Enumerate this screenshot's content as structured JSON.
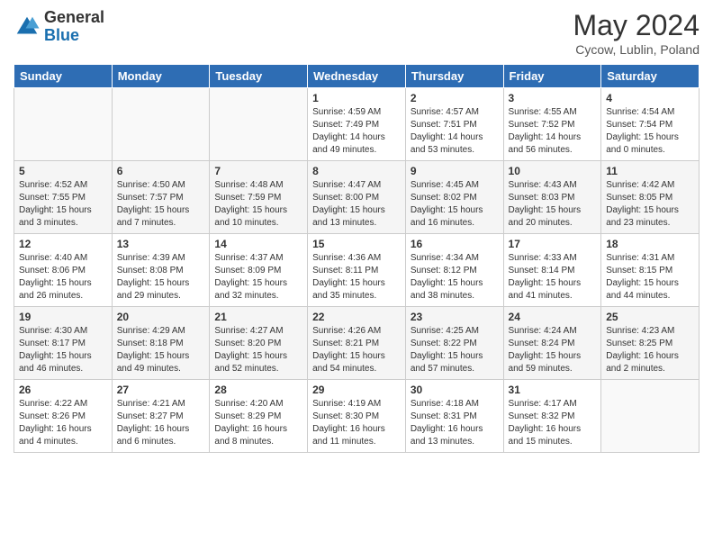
{
  "header": {
    "logo_general": "General",
    "logo_blue": "Blue",
    "month_title": "May 2024",
    "location": "Cycow, Lublin, Poland"
  },
  "days_of_week": [
    "Sunday",
    "Monday",
    "Tuesday",
    "Wednesday",
    "Thursday",
    "Friday",
    "Saturday"
  ],
  "weeks": [
    [
      {
        "day": "",
        "info": ""
      },
      {
        "day": "",
        "info": ""
      },
      {
        "day": "",
        "info": ""
      },
      {
        "day": "1",
        "info": "Sunrise: 4:59 AM\nSunset: 7:49 PM\nDaylight: 14 hours\nand 49 minutes."
      },
      {
        "day": "2",
        "info": "Sunrise: 4:57 AM\nSunset: 7:51 PM\nDaylight: 14 hours\nand 53 minutes."
      },
      {
        "day": "3",
        "info": "Sunrise: 4:55 AM\nSunset: 7:52 PM\nDaylight: 14 hours\nand 56 minutes."
      },
      {
        "day": "4",
        "info": "Sunrise: 4:54 AM\nSunset: 7:54 PM\nDaylight: 15 hours\nand 0 minutes."
      }
    ],
    [
      {
        "day": "5",
        "info": "Sunrise: 4:52 AM\nSunset: 7:55 PM\nDaylight: 15 hours\nand 3 minutes."
      },
      {
        "day": "6",
        "info": "Sunrise: 4:50 AM\nSunset: 7:57 PM\nDaylight: 15 hours\nand 7 minutes."
      },
      {
        "day": "7",
        "info": "Sunrise: 4:48 AM\nSunset: 7:59 PM\nDaylight: 15 hours\nand 10 minutes."
      },
      {
        "day": "8",
        "info": "Sunrise: 4:47 AM\nSunset: 8:00 PM\nDaylight: 15 hours\nand 13 minutes."
      },
      {
        "day": "9",
        "info": "Sunrise: 4:45 AM\nSunset: 8:02 PM\nDaylight: 15 hours\nand 16 minutes."
      },
      {
        "day": "10",
        "info": "Sunrise: 4:43 AM\nSunset: 8:03 PM\nDaylight: 15 hours\nand 20 minutes."
      },
      {
        "day": "11",
        "info": "Sunrise: 4:42 AM\nSunset: 8:05 PM\nDaylight: 15 hours\nand 23 minutes."
      }
    ],
    [
      {
        "day": "12",
        "info": "Sunrise: 4:40 AM\nSunset: 8:06 PM\nDaylight: 15 hours\nand 26 minutes."
      },
      {
        "day": "13",
        "info": "Sunrise: 4:39 AM\nSunset: 8:08 PM\nDaylight: 15 hours\nand 29 minutes."
      },
      {
        "day": "14",
        "info": "Sunrise: 4:37 AM\nSunset: 8:09 PM\nDaylight: 15 hours\nand 32 minutes."
      },
      {
        "day": "15",
        "info": "Sunrise: 4:36 AM\nSunset: 8:11 PM\nDaylight: 15 hours\nand 35 minutes."
      },
      {
        "day": "16",
        "info": "Sunrise: 4:34 AM\nSunset: 8:12 PM\nDaylight: 15 hours\nand 38 minutes."
      },
      {
        "day": "17",
        "info": "Sunrise: 4:33 AM\nSunset: 8:14 PM\nDaylight: 15 hours\nand 41 minutes."
      },
      {
        "day": "18",
        "info": "Sunrise: 4:31 AM\nSunset: 8:15 PM\nDaylight: 15 hours\nand 44 minutes."
      }
    ],
    [
      {
        "day": "19",
        "info": "Sunrise: 4:30 AM\nSunset: 8:17 PM\nDaylight: 15 hours\nand 46 minutes."
      },
      {
        "day": "20",
        "info": "Sunrise: 4:29 AM\nSunset: 8:18 PM\nDaylight: 15 hours\nand 49 minutes."
      },
      {
        "day": "21",
        "info": "Sunrise: 4:27 AM\nSunset: 8:20 PM\nDaylight: 15 hours\nand 52 minutes."
      },
      {
        "day": "22",
        "info": "Sunrise: 4:26 AM\nSunset: 8:21 PM\nDaylight: 15 hours\nand 54 minutes."
      },
      {
        "day": "23",
        "info": "Sunrise: 4:25 AM\nSunset: 8:22 PM\nDaylight: 15 hours\nand 57 minutes."
      },
      {
        "day": "24",
        "info": "Sunrise: 4:24 AM\nSunset: 8:24 PM\nDaylight: 15 hours\nand 59 minutes."
      },
      {
        "day": "25",
        "info": "Sunrise: 4:23 AM\nSunset: 8:25 PM\nDaylight: 16 hours\nand 2 minutes."
      }
    ],
    [
      {
        "day": "26",
        "info": "Sunrise: 4:22 AM\nSunset: 8:26 PM\nDaylight: 16 hours\nand 4 minutes."
      },
      {
        "day": "27",
        "info": "Sunrise: 4:21 AM\nSunset: 8:27 PM\nDaylight: 16 hours\nand 6 minutes."
      },
      {
        "day": "28",
        "info": "Sunrise: 4:20 AM\nSunset: 8:29 PM\nDaylight: 16 hours\nand 8 minutes."
      },
      {
        "day": "29",
        "info": "Sunrise: 4:19 AM\nSunset: 8:30 PM\nDaylight: 16 hours\nand 11 minutes."
      },
      {
        "day": "30",
        "info": "Sunrise: 4:18 AM\nSunset: 8:31 PM\nDaylight: 16 hours\nand 13 minutes."
      },
      {
        "day": "31",
        "info": "Sunrise: 4:17 AM\nSunset: 8:32 PM\nDaylight: 16 hours\nand 15 minutes."
      },
      {
        "day": "",
        "info": ""
      }
    ]
  ]
}
